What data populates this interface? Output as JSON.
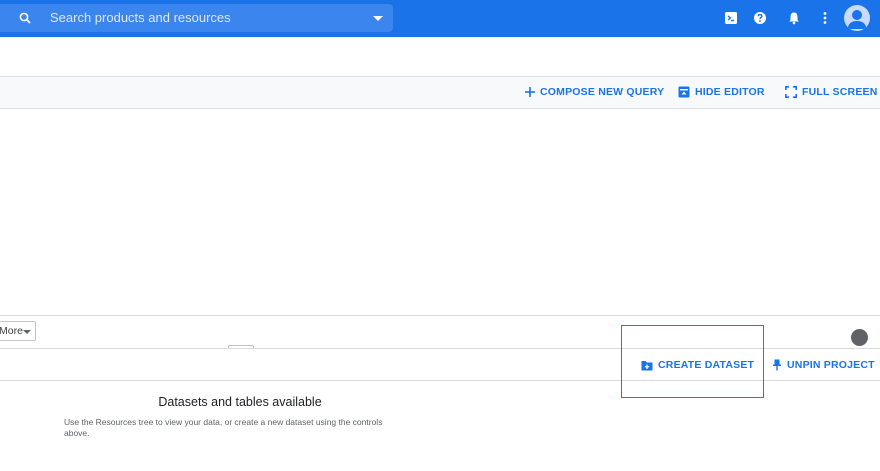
{
  "search": {
    "placeholder": "Search products and resources"
  },
  "top_icons": [
    "cloud-shell-icon",
    "help-icon",
    "notifications-icon",
    "more-vert-icon",
    "account-avatar-icon"
  ],
  "editor_toolbar": {
    "compose_label": "COMPOSE NEW QUERY",
    "hide_editor_label": "HIDE EDITOR",
    "full_screen_label": "FULL SCREEN"
  },
  "query_controls": {
    "more_label": "More"
  },
  "resource_toolbar": {
    "create_dataset_label": "CREATE DATASET",
    "unpin_project_label": "UNPIN PROJECT"
  },
  "empty_state": {
    "title": "Datasets and tables available",
    "description": "Use the Resources tree to view your data, or create a new dataset using the controls above."
  },
  "colors": {
    "brand": "#1a73e8",
    "highlight": "#e53935"
  }
}
